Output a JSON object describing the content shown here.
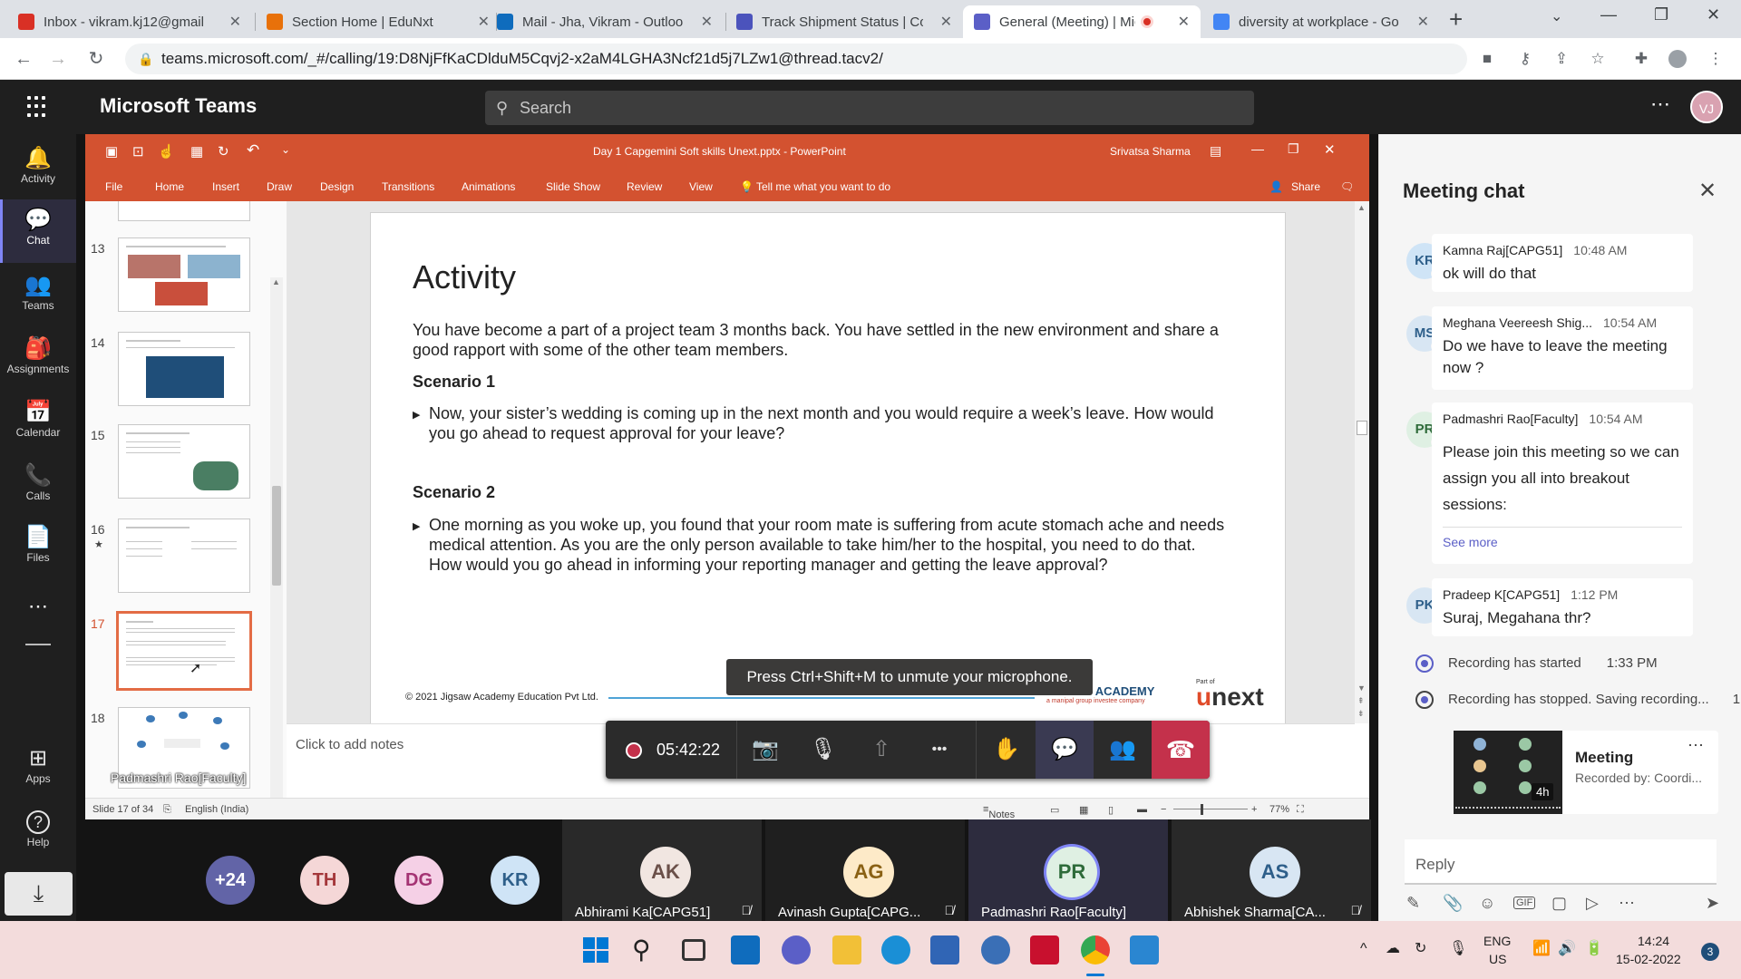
{
  "browser": {
    "tabs": [
      {
        "title": "Inbox - vikram.kj12@gmail.com",
        "favicon_color": "#d93025"
      },
      {
        "title": "Section Home | EduNxt",
        "favicon_color": "#e8710a"
      },
      {
        "title": "Mail - Jha, Vikram - Outlook",
        "favicon_color": "#0f6cbd"
      },
      {
        "title": "Track Shipment Status | Cor",
        "favicon_color": "#4b53bc"
      },
      {
        "title": "General (Meeting) | Mic",
        "favicon_color": "#5b5fc7"
      },
      {
        "title": "diversity at workplace - Go",
        "favicon_color": "#4285f4"
      }
    ],
    "new_tab": "+",
    "url": "teams.microsoft.com/_#/calling/19:D8NjFfKaCDlduM5Cqvj2-x2aM4LGHA3Ncf21d5j7LZw1@thread.tacv2/"
  },
  "teams": {
    "app_name": "Microsoft Teams",
    "search_placeholder": "Search",
    "user_initials": "VJ",
    "more": "⋯",
    "rail": [
      {
        "label": "Activity",
        "icon": "bell-icon",
        "glyph": "🔔"
      },
      {
        "label": "Chat",
        "icon": "chat-icon",
        "glyph": "💬"
      },
      {
        "label": "Teams",
        "icon": "teams-icon",
        "glyph": "👥"
      },
      {
        "label": "Assignments",
        "icon": "assignments-icon",
        "glyph": "🎒"
      },
      {
        "label": "Calendar",
        "icon": "calendar-icon",
        "glyph": "📅"
      },
      {
        "label": "Calls",
        "icon": "phone-icon",
        "glyph": "📞"
      },
      {
        "label": "Files",
        "icon": "file-icon",
        "glyph": "📄"
      },
      {
        "label": "Apps",
        "icon": "apps-icon",
        "glyph": "⊞"
      },
      {
        "label": "Help",
        "icon": "help-icon",
        "glyph": "?"
      }
    ]
  },
  "powerpoint": {
    "file_title": "Day 1 Capgemini Soft skills Unext.pptx  -  PowerPoint",
    "user": "Srivatsa Sharma",
    "ribbon": [
      "File",
      "Home",
      "Insert",
      "Draw",
      "Design",
      "Transitions",
      "Animations",
      "Slide Show",
      "Review",
      "View"
    ],
    "tell_me": "Tell me what you want to do",
    "share": "Share",
    "thumb_numbers": [
      "13",
      "14",
      "15",
      "16",
      "17",
      "18"
    ],
    "thumb_star": "★",
    "thumb_overlay": "Padmashri Rao[Faculty]",
    "notes_placeholder": "Click to add notes",
    "status": {
      "slide": "Slide 17 of 34",
      "language": "English (India)",
      "notes": "Notes",
      "zoom": "77%"
    },
    "slide": {
      "title": "Activity",
      "intro": "You have become a part of a project team 3 months back. You have settled in the new environment and share a good rapport with some of the other team members.",
      "scenario1_heading": "Scenario 1",
      "scenario1_text": "Now, your sister’s wedding is coming up in the next month and you would require a week’s leave. How would you go ahead to request approval for your leave?",
      "scenario2_heading": "Scenario 2",
      "scenario2_text": "One morning as you woke up, you found that your room mate is suffering from acute stomach ache and needs medical attention. As you are the only person available to take him/her to the hospital, you need to do that. How would you go ahead in informing your reporting manager and getting the leave approval?",
      "copyright": "© 2021 Jigsaw Academy Education Pvt Ltd.",
      "jigsaw_logo": "JIGSAW ACADEMY",
      "jigsaw_sub": "a manipal group investee company",
      "unext_part": "Part of",
      "unext_logo_u": "u",
      "unext_logo_rest": "next"
    }
  },
  "call": {
    "toast": "Press Ctrl+Shift+M to unmute your microphone.",
    "timer": "05:42:22",
    "controls": [
      {
        "name": "camera-off-button",
        "glyph": "📷"
      },
      {
        "name": "mic-off-button",
        "glyph": "🎙"
      },
      {
        "name": "share-button",
        "glyph": "⇧"
      },
      {
        "name": "more-actions-button",
        "glyph": "•••"
      },
      {
        "name": "raise-hand-button",
        "glyph": "✋"
      },
      {
        "name": "chat-toggle-button",
        "glyph": "💬"
      },
      {
        "name": "participants-button",
        "glyph": "👥"
      }
    ],
    "hangup_glyph": "☎"
  },
  "participants": {
    "bubbles": [
      {
        "text": "+24",
        "bg": "#6264a7",
        "fg": "#ffffff"
      },
      {
        "text": "TH",
        "bg": "#f5d7d7",
        "fg": "#a4373a"
      },
      {
        "text": "DG",
        "bg": "#f5d0e6",
        "fg": "#a43373"
      },
      {
        "text": "KR",
        "bg": "#cfe4f6",
        "fg": "#2e5f8a"
      }
    ],
    "tiles": [
      {
        "initials": "AK",
        "name": "Abhirami Ka[CAPG51]",
        "bg": "#f1e6e1",
        "fg": "#6b5049",
        "tile": "#292929"
      },
      {
        "initials": "AG",
        "name": "Avinash Gupta[CAPG...",
        "bg": "#fdeac8",
        "fg": "#8a6114",
        "tile": "#1f1f1f"
      },
      {
        "initials": "PR",
        "name": "Padmashri Rao[Faculty]",
        "bg": "#dff0e3",
        "fg": "#2e6b3a",
        "tile": "#2d2c3e"
      },
      {
        "initials": "AS",
        "name": "Abhishek Sharma[CA...",
        "bg": "#d8e6f3",
        "fg": "#2e5f8a",
        "tile": "#292929"
      }
    ]
  },
  "chat": {
    "title": "Meeting chat",
    "messages": [
      {
        "initials": "KR",
        "author": "Kamna Raj[CAPG51]",
        "time": "10:48 AM",
        "text": "ok will do that",
        "av_bg": "#cfe4f6",
        "av_fg": "#2e5f8a"
      },
      {
        "initials": "MS",
        "author": "Meghana Veereesh Shig...",
        "time": "10:54 AM",
        "text": "Do we have to leave the meeting now ?",
        "av_bg": "#d8e6f3",
        "av_fg": "#2e5f8a"
      },
      {
        "initials": "PR",
        "author": "Padmashri Rao[Faculty]",
        "time": "10:54 AM",
        "text": "Please join this meeting so we can assign you all into breakout sessions:",
        "see_more": "See more",
        "av_bg": "#dff0e3",
        "av_fg": "#2e6b3a"
      },
      {
        "initials": "PK",
        "author": "Pradeep K[CAPG51]",
        "time": "1:12 PM",
        "text": "Suraj, Megahana thr?",
        "av_bg": "#d8e6f3",
        "av_fg": "#2e5f8a"
      }
    ],
    "system": [
      {
        "text": "Recording has started",
        "time": "1:33 PM"
      },
      {
        "text": "Recording has stopped. Saving recording...",
        "time": "1"
      }
    ],
    "recording_card": {
      "title": "Meeting",
      "subtitle": "Recorded by: Coordi...",
      "duration": "4h",
      "more": "⋯"
    },
    "reply_placeholder": "Reply"
  },
  "taskbar": {
    "lang": "ENG",
    "region": "US",
    "time": "14:24",
    "date": "15-02-2022",
    "notif_count": "3"
  }
}
